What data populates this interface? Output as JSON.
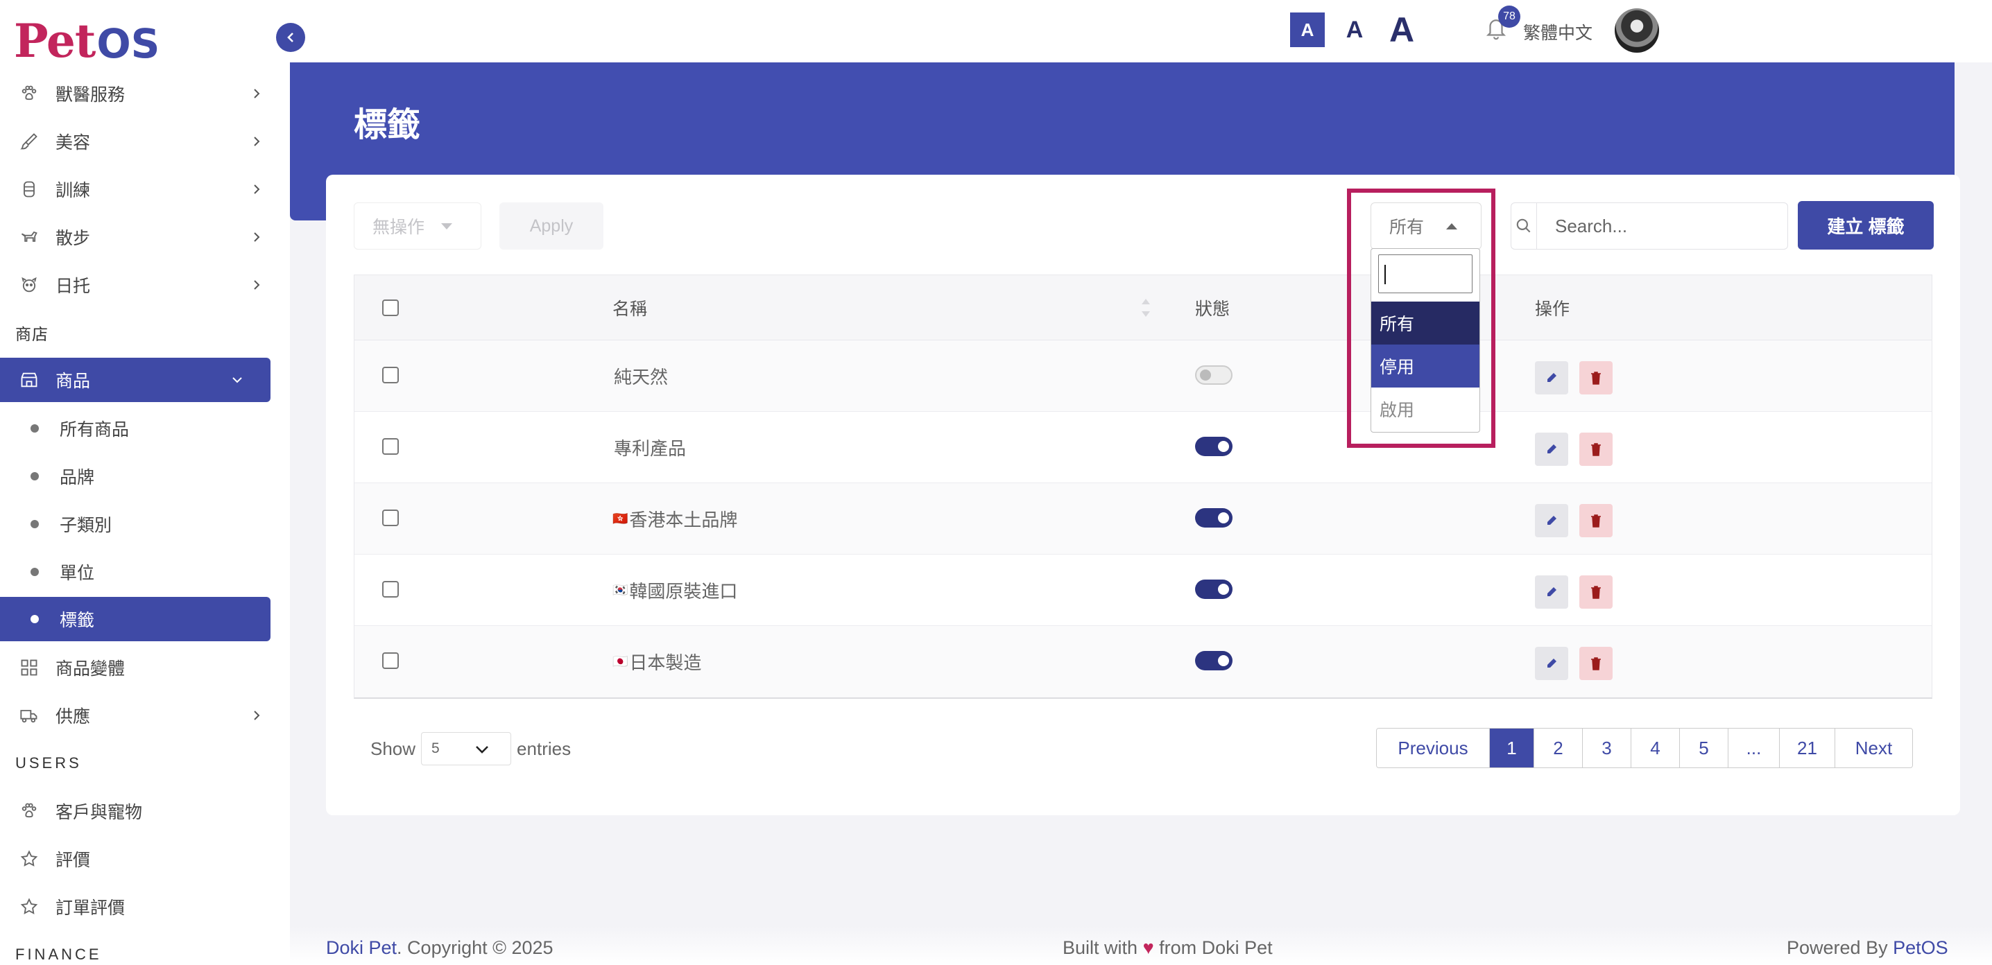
{
  "logo": {
    "pet": "Pet",
    "os": "OS"
  },
  "sidebar": {
    "items_top": [
      {
        "label": "獸醫服務",
        "icon": "paw-icon"
      },
      {
        "label": "美容",
        "icon": "brush-icon"
      },
      {
        "label": "訓練",
        "icon": "training-icon"
      },
      {
        "label": "散步",
        "icon": "walk-dog-icon"
      },
      {
        "label": "日托",
        "icon": "daycare-icon"
      }
    ],
    "section_shop": "商店",
    "products_label": "商品",
    "sub_items": [
      "所有商品",
      "品牌",
      "子類別",
      "單位",
      "標籤"
    ],
    "item_variants": "商品變體",
    "item_supply": "供應",
    "section_users": "USERS",
    "item_customers": "客戶與寵物",
    "item_reviews": "評價",
    "item_order_reviews": "訂單評價",
    "section_finance": "FINANCE"
  },
  "topbar": {
    "font_small": "A",
    "font_medium": "A",
    "font_large": "A",
    "notification_count": "78",
    "language": "繁體中文"
  },
  "page": {
    "title": "標籤"
  },
  "toolbar": {
    "bulk_action": "無操作",
    "apply": "Apply",
    "status_filter": "所有",
    "search_placeholder": "Search...",
    "create": "建立 標籤"
  },
  "status_dropdown": {
    "options": [
      "所有",
      "停用",
      "啟用"
    ],
    "highlighted": "停用",
    "selected": "所有"
  },
  "table": {
    "headers": {
      "name": "名稱",
      "status": "狀態",
      "actions": "操作"
    },
    "rows": [
      {
        "flag": "",
        "name": "純天然",
        "enabled": false
      },
      {
        "flag": "",
        "name": "專利產品",
        "enabled": true
      },
      {
        "flag": "🇭🇰",
        "name": "香港本土品牌",
        "enabled": true
      },
      {
        "flag": "🇰🇷",
        "name": "韓國原裝進口",
        "enabled": true
      },
      {
        "flag": "🇯🇵",
        "name": "日本製造",
        "enabled": true
      }
    ]
  },
  "length": {
    "show": "Show",
    "value": "5",
    "entries": "entries"
  },
  "pagination": {
    "previous": "Previous",
    "pages": [
      "1",
      "2",
      "3",
      "4",
      "5",
      "...",
      "21"
    ],
    "next": "Next",
    "current": "1"
  },
  "footer": {
    "brand": "Doki Pet",
    "copyright": ". Copyright © 2025",
    "built_prefix": "Built with",
    "heart": "♥",
    "built_suffix": "from Doki Pet",
    "powered_prefix": "Powered By",
    "powered_brand": "PetOS"
  },
  "colors": {
    "primary": "#3f4aa6",
    "band": "#424eb0",
    "accent": "#c2255c",
    "danger": "#9b1c1c"
  }
}
